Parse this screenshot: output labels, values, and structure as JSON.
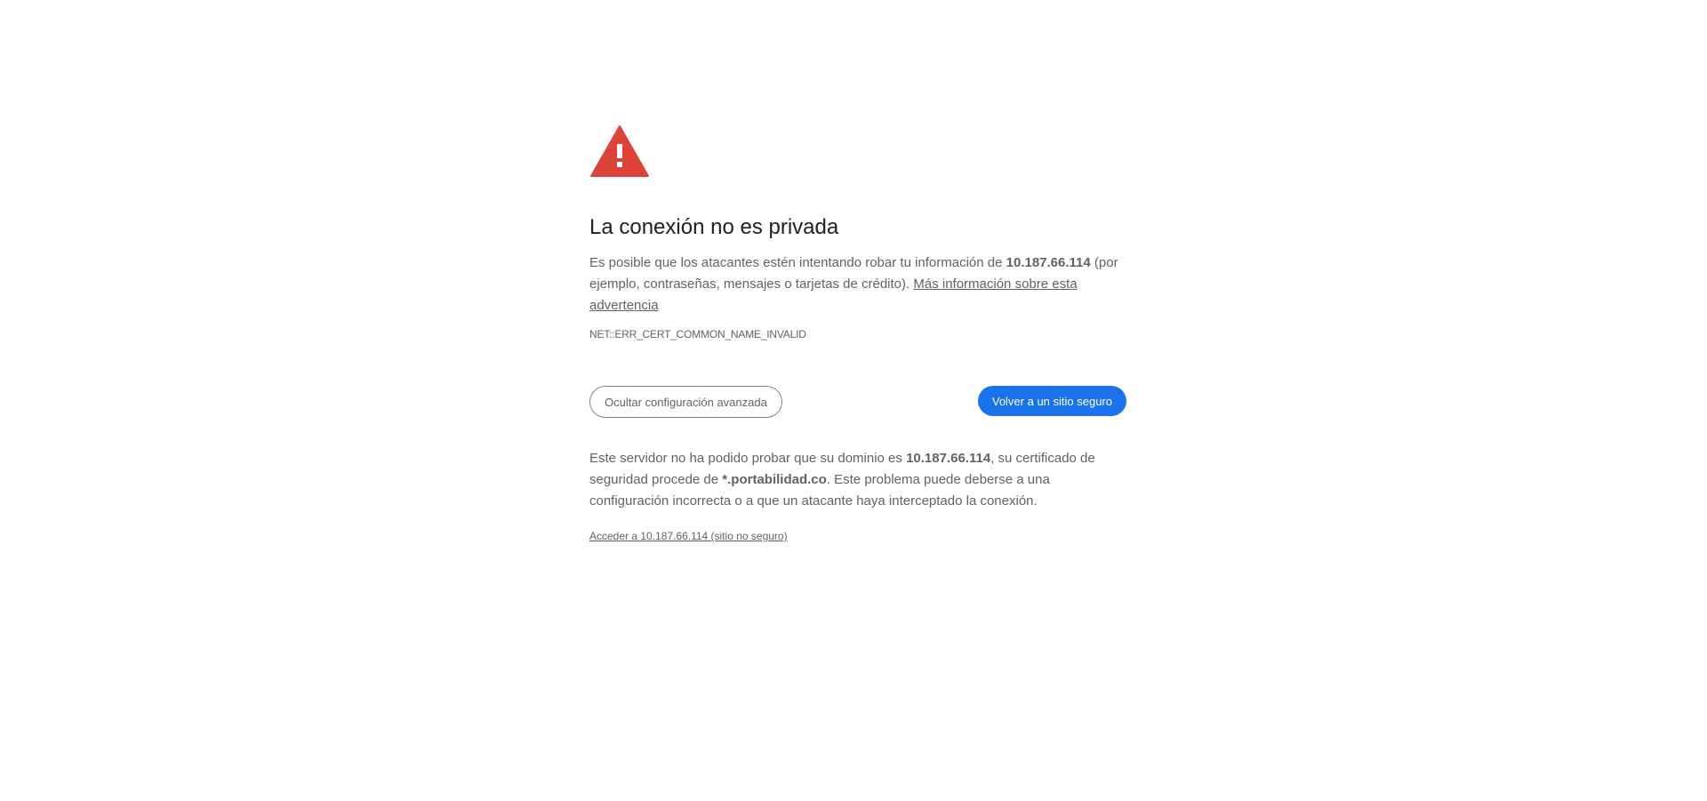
{
  "icon": "warning-triangle-icon",
  "colors": {
    "warning_red": "#db4437",
    "primary_blue": "#1a73e8",
    "text_gray": "#5f6368",
    "title_dark": "#202124"
  },
  "title": "La conexión no es privada",
  "explanation": {
    "before_host": "Es posible que los atacantes estén intentando robar tu información de ",
    "host": "10.187.66.114",
    "after_host": " (por ejemplo, contraseñas, mensajes o tarjetas de crédito). ",
    "learn_more_link": "Más información sobre esta advertencia"
  },
  "error_code": "NET::ERR_CERT_COMMON_NAME_INVALID",
  "buttons": {
    "advanced": "Ocultar configuración avanzada",
    "back": "Volver a un sitio seguro"
  },
  "details": {
    "part1": "Este servidor no ha podido probar que su dominio es ",
    "host": "10.187.66.114",
    "part2": ", su certificado de seguridad procede de ",
    "cert_domain": "*.portabilidad.co",
    "part3": ". Este problema puede deberse a una configuración incorrecta o a que un atacante haya interceptado la conexión."
  },
  "proceed_link": "Acceder a 10.187.66.114 (sitio no seguro)"
}
